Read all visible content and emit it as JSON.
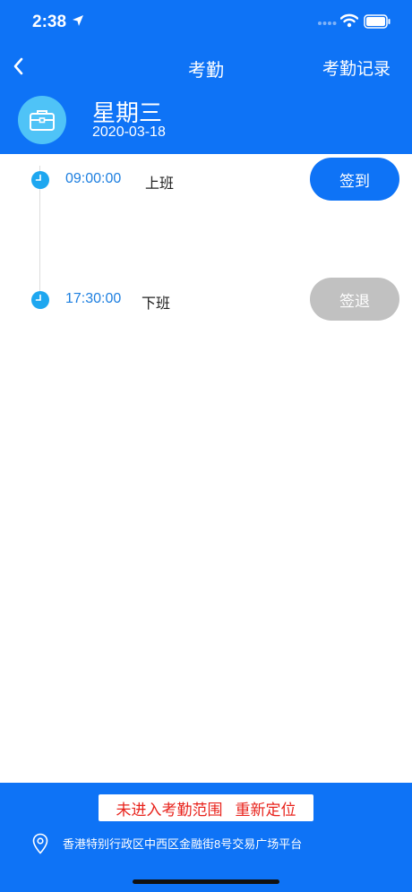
{
  "status_bar": {
    "time": "2:38",
    "battery_level": 1.0
  },
  "nav": {
    "title": "考勤",
    "right_action": "考勤记录"
  },
  "day": {
    "weekday": "星期三",
    "date": "2020-03-18"
  },
  "shifts": [
    {
      "time": "09:00:00",
      "label": "上班",
      "button": "签到",
      "button_state": "active",
      "button_color": "#0e73f6"
    },
    {
      "time": "17:30:00",
      "label": "下班",
      "button": "签退",
      "button_state": "disabled",
      "button_color": "#c1c1c1"
    }
  ],
  "footer": {
    "warning": "未进入考勤范围",
    "relocate": "重新定位",
    "address": "香港特别行政区中西区金融街8号交易广场平台"
  },
  "colors": {
    "primary": "#0e73f6",
    "warning": "#e8231c",
    "timeline_dot": "#1ea7f0"
  }
}
